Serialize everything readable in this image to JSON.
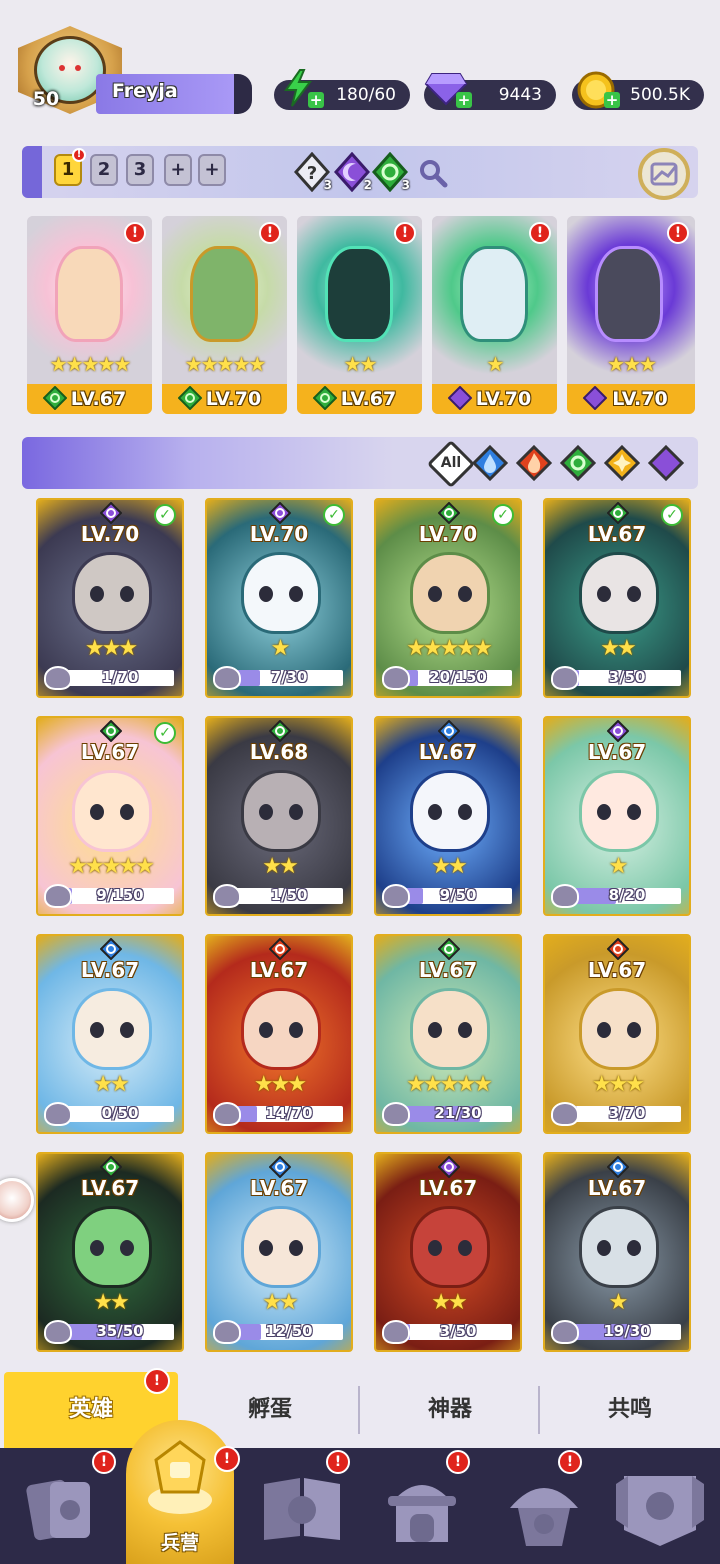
{
  "player": {
    "level": "50",
    "name": "Freyja"
  },
  "resources": {
    "energy": "180/60",
    "gems": "9443",
    "gold": "500.5K"
  },
  "team_bar": {
    "tabs": [
      "1",
      "2",
      "3",
      "+",
      "+"
    ],
    "active_tab": "1",
    "active_tab_badge": "!",
    "synergies": [
      {
        "icon": "question-synergy-icon",
        "count": "3"
      },
      {
        "icon": "dark-synergy-icon",
        "count": "2"
      },
      {
        "icon": "nature-synergy-icon",
        "count": "3"
      }
    ]
  },
  "team_slots": [
    {
      "level": "LV.67",
      "stars": "★★★★★",
      "element": "nature",
      "badge": "!"
    },
    {
      "level": "LV.70",
      "stars": "★★★★★",
      "element": "nature",
      "badge": "!"
    },
    {
      "level": "LV.67",
      "stars": "★★",
      "element": "nature",
      "badge": "!"
    },
    {
      "level": "LV.70",
      "stars": "★",
      "element": "dark",
      "badge": "!"
    },
    {
      "level": "LV.70",
      "stars": "★★★",
      "element": "dark",
      "badge": "!"
    }
  ],
  "filters": {
    "all_label": "All",
    "elements": [
      "water",
      "fire",
      "nature",
      "light",
      "dark"
    ]
  },
  "heroes": [
    {
      "level": "LV.70",
      "element": "dark",
      "checked": true,
      "stars": "★★★",
      "shards": "1/70",
      "progress": 0.014
    },
    {
      "level": "LV.70",
      "element": "dark",
      "checked": true,
      "stars": "★",
      "shards": "7/30",
      "progress": 0.23
    },
    {
      "level": "LV.70",
      "element": "nature",
      "checked": true,
      "stars": "★★★★★",
      "shards": "20/150",
      "progress": 0.13
    },
    {
      "level": "LV.67",
      "element": "nature",
      "checked": true,
      "stars": "★★",
      "shards": "3/50",
      "progress": 0.06
    },
    {
      "level": "LV.67",
      "element": "nature",
      "checked": true,
      "stars": "★★★★★",
      "shards": "9/150",
      "progress": 0.06
    },
    {
      "level": "LV.68",
      "element": "nature",
      "checked": false,
      "stars": "★★",
      "shards": "1/50",
      "progress": 0.02
    },
    {
      "level": "LV.67",
      "element": "water",
      "checked": false,
      "stars": "★★",
      "shards": "9/50",
      "progress": 0.18
    },
    {
      "level": "LV.67",
      "element": "dark",
      "checked": false,
      "stars": "★",
      "shards": "8/20",
      "progress": 0.4
    },
    {
      "level": "LV.67",
      "element": "water",
      "checked": false,
      "stars": "★★",
      "shards": "0/50",
      "progress": 0.0
    },
    {
      "level": "LV.67",
      "element": "fire",
      "checked": false,
      "stars": "★★★",
      "shards": "14/70",
      "progress": 0.2
    },
    {
      "level": "LV.67",
      "element": "nature",
      "checked": false,
      "stars": "★★★★★",
      "shards": "21/30",
      "progress": 0.7
    },
    {
      "level": "LV.67",
      "element": "fire",
      "checked": false,
      "stars": "★★★",
      "shards": "3/70",
      "progress": 0.04
    },
    {
      "level": "LV.67",
      "element": "nature",
      "checked": false,
      "stars": "★★",
      "shards": "35/50",
      "progress": 0.7
    },
    {
      "level": "LV.67",
      "element": "water",
      "checked": false,
      "stars": "★★",
      "shards": "12/50",
      "progress": 0.24
    },
    {
      "level": "LV.67",
      "element": "dark",
      "checked": false,
      "stars": "★★",
      "shards": "3/50",
      "progress": 0.06
    },
    {
      "level": "LV.67",
      "element": "water",
      "checked": false,
      "stars": "★",
      "shards": "19/30",
      "progress": 0.63
    }
  ],
  "subtabs": {
    "heroes": "英雄",
    "hatch": "孵蛋",
    "artifacts": "神器",
    "resonance": "共鸣",
    "badge": "!"
  },
  "navbar": {
    "barracks_label": "兵营",
    "badge": "!"
  },
  "colors": {
    "water": "#2f7fe0",
    "fire": "#e0421d",
    "nature": "#2fae3c",
    "light": "#f2b21a",
    "dark": "#8a4fd8",
    "accent": "#7567d9",
    "gold": "#f5b21d"
  }
}
